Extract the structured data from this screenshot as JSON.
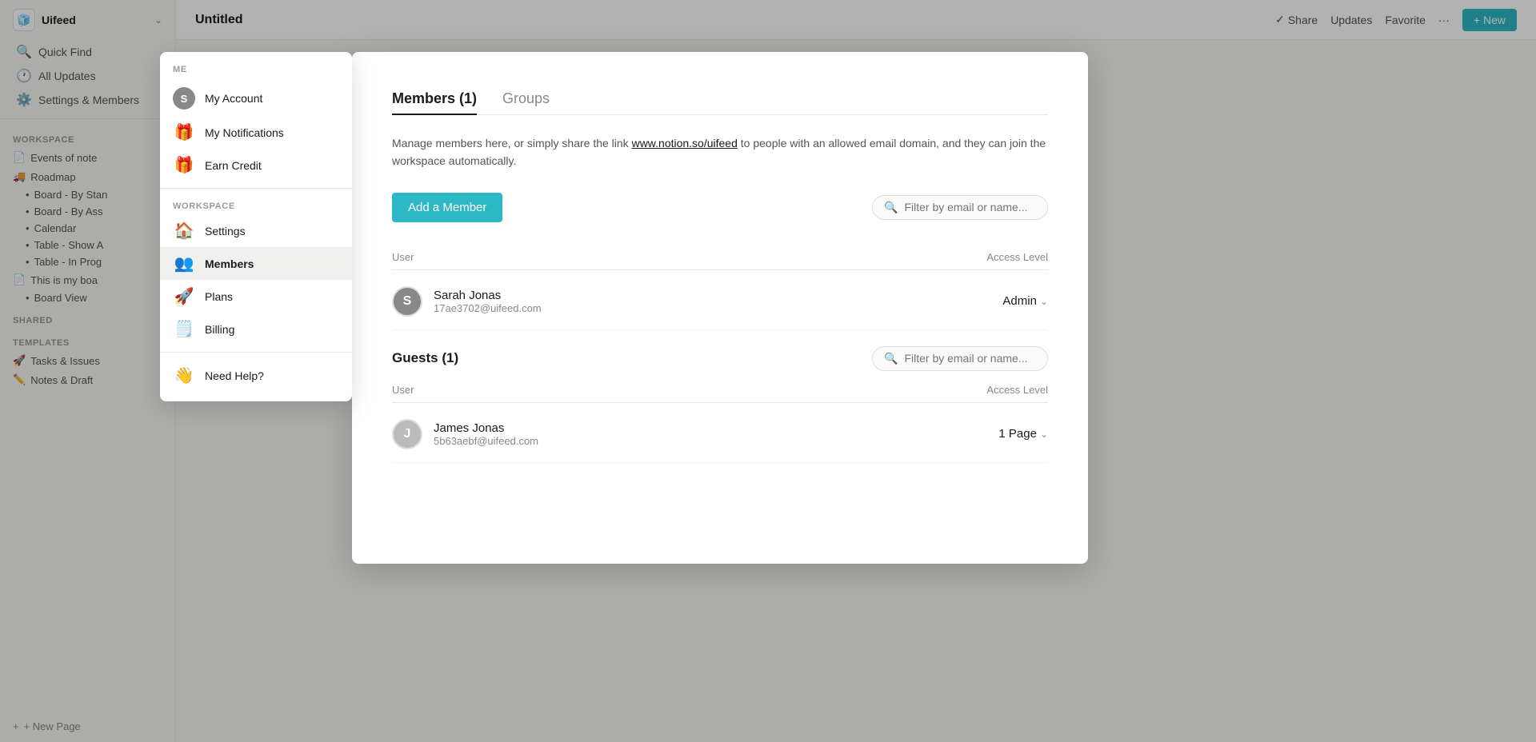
{
  "app": {
    "name": "Uifeed",
    "page_title": "Untitled"
  },
  "topbar": {
    "title": "Untitled",
    "share_label": "Share",
    "updates_label": "Updates",
    "favorite_label": "Favorite",
    "more_label": "···",
    "new_label": "+ New"
  },
  "sidebar": {
    "workspace_name": "Uifeed",
    "quick_find": "Quick Find",
    "all_updates": "All Updates",
    "settings": "Settings & Members",
    "workspace_label": "WORKSPACE",
    "items": [
      {
        "icon": "📄",
        "label": "Events of note"
      },
      {
        "icon": "🚚",
        "label": "Roadmap"
      }
    ],
    "sub_items": [
      "Board - By Stan",
      "Board - By Ass",
      "Calendar",
      "Table - Show A",
      "Table - In Prog"
    ],
    "page2_label": "This is my boa",
    "page2_sub": "Board View",
    "shared_label": "SHARED",
    "templates_label": "TEMPLATES",
    "template_items": [
      {
        "icon": "🚀",
        "label": "Tasks & Issues"
      },
      {
        "icon": "✏️",
        "label": "Notes & Draft"
      }
    ],
    "new_page_label": "+ New Page"
  },
  "dropdown": {
    "me_label": "ME",
    "my_account_label": "My Account",
    "my_notifications_label": "My Notifications",
    "earn_credit_label": "Earn Credit",
    "workspace_label": "WORKSPACE",
    "settings_label": "Settings",
    "members_label": "Members",
    "plans_label": "Plans",
    "billing_label": "Billing",
    "need_help_label": "Need Help?",
    "account_avatar": "S"
  },
  "modal": {
    "tab_members": "Members (1)",
    "tab_groups": "Groups",
    "description": "Manage members here, or simply share the link",
    "link_text": "www.notion.so/uifeed",
    "description_suffix": " to people with an allowed email domain, and they can join the workspace automatically.",
    "add_member_label": "Add a Member",
    "filter_placeholder": "Filter by email or name...",
    "user_column": "User",
    "access_column": "Access Level",
    "members": [
      {
        "name": "Sarah Jonas",
        "email": "17ae3702@uifeed.com",
        "avatar": "S",
        "access": "Admin"
      }
    ],
    "guests_title": "Guests (1)",
    "guests_filter_placeholder": "Filter by email or name...",
    "guests_user_column": "User",
    "guests_access_column": "Access Level",
    "guests": [
      {
        "name": "James Jonas",
        "email": "5b63aebf@uifeed.com",
        "avatar": "J",
        "access": "1 Page"
      }
    ]
  }
}
